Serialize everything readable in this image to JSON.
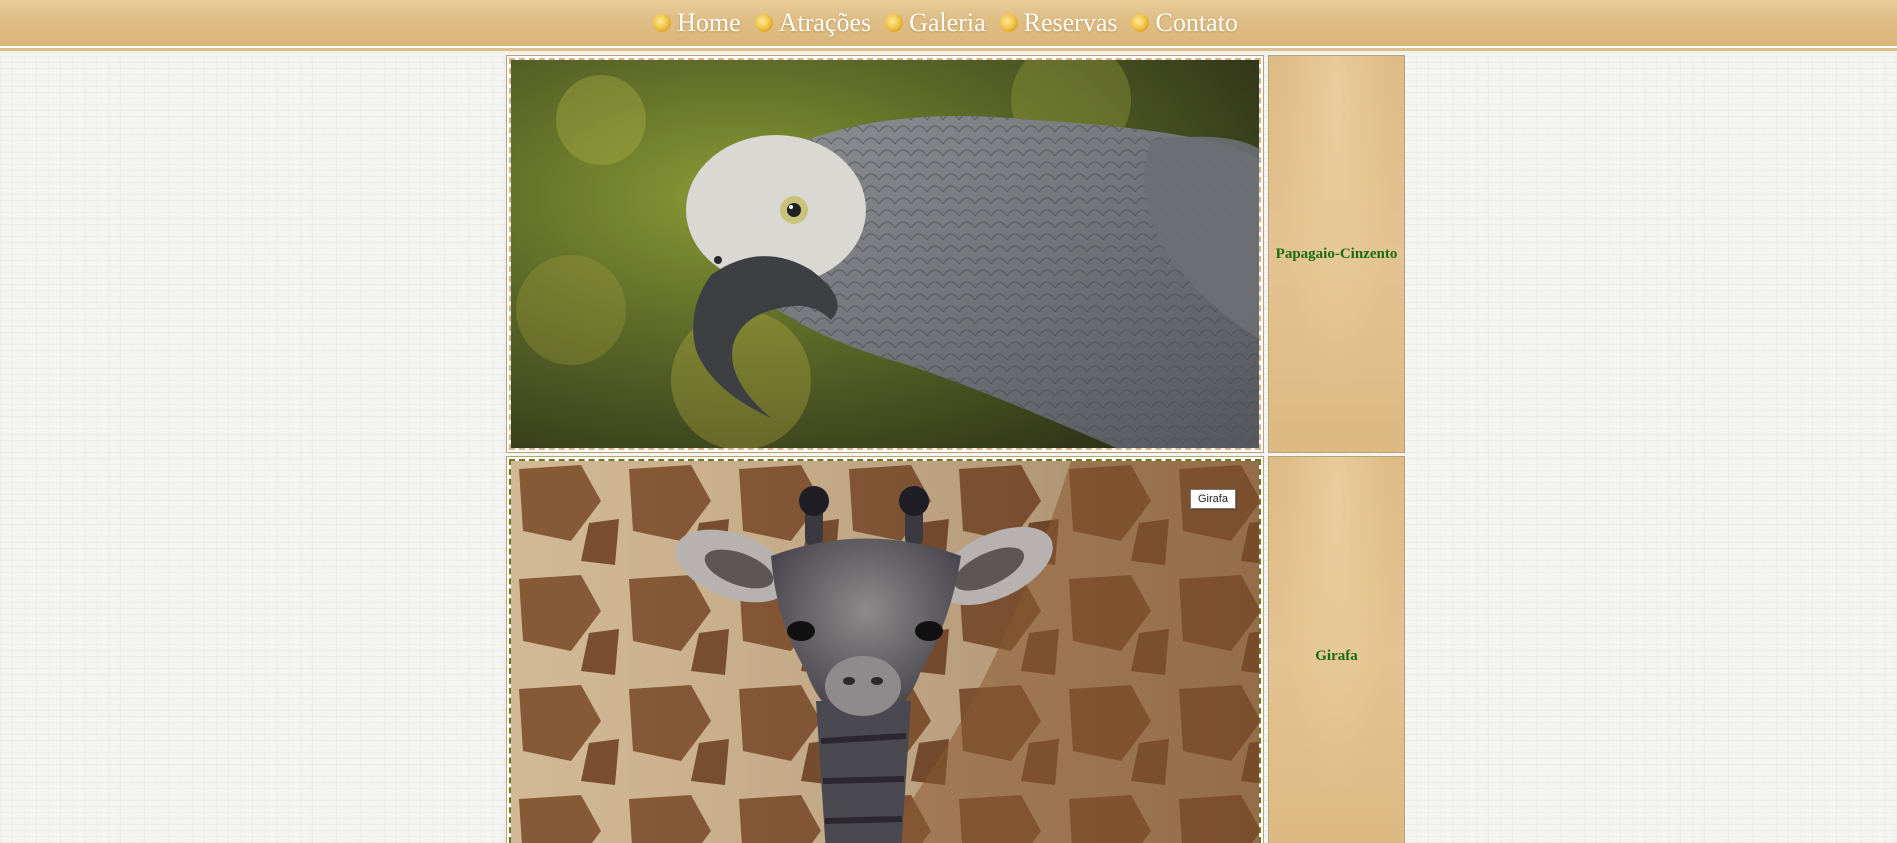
{
  "nav": {
    "items": [
      {
        "label": "Home",
        "icon": "bullet-icon"
      },
      {
        "label": "Atrações",
        "icon": "bullet-icon"
      },
      {
        "label": "Galeria",
        "icon": "bullet-icon"
      },
      {
        "label": "Reservas",
        "icon": "bullet-icon"
      },
      {
        "label": "Contato",
        "icon": "bullet-icon"
      }
    ]
  },
  "gallery": {
    "animals": [
      {
        "name": "Papagaio-Cinzento"
      },
      {
        "name": "Girafa"
      }
    ],
    "tooltip": "Girafa"
  },
  "colors": {
    "nav_bg": "#dfbe86",
    "name_text": "#1a6b14",
    "name_cell_bg": "#e3c390"
  }
}
